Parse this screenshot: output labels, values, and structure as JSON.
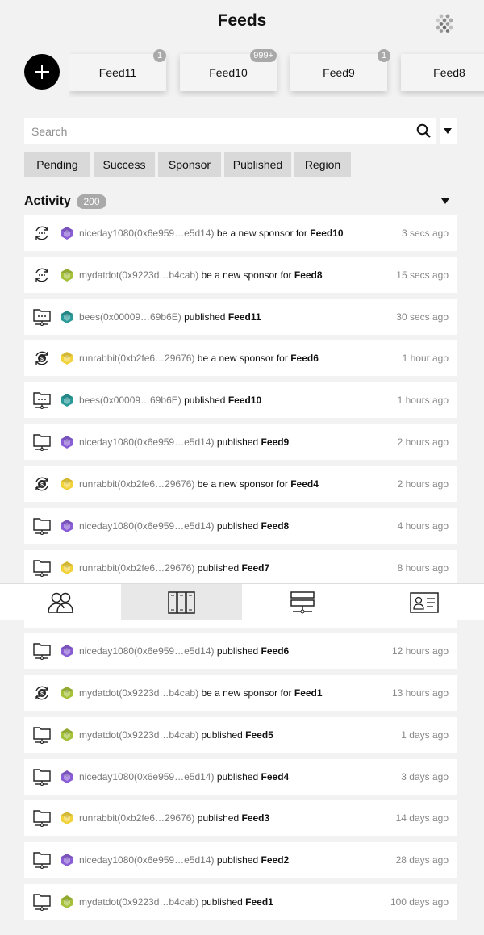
{
  "header": {
    "title": "Feeds",
    "menu_icon": "hexagon-grid-icon"
  },
  "add_button": {
    "icon": "plus-icon"
  },
  "feeds": [
    {
      "label": "Feed11",
      "badge": "1"
    },
    {
      "label": "Feed10",
      "badge": "999+"
    },
    {
      "label": "Feed9",
      "badge": "1"
    },
    {
      "label": "Feed8",
      "badge": ""
    }
  ],
  "search": {
    "placeholder": "Search"
  },
  "filters": [
    "Pending",
    "Success",
    "Sponsor",
    "Published",
    "Region"
  ],
  "activity": {
    "title": "Activity",
    "count": "200",
    "items": [
      {
        "kind": "sponsor-new",
        "avatar": "purple",
        "user": "niceday1080(0x6e959…e5d14)",
        "action": "be a new sponsor for",
        "feed": "Feed10",
        "time": "3 secs ago"
      },
      {
        "kind": "sponsor-new",
        "avatar": "green",
        "user": "mydatdot(0x9223d…b4cab)",
        "action": "be a new sponsor for",
        "feed": "Feed8",
        "time": "15 secs ago"
      },
      {
        "kind": "publish-pending",
        "avatar": "teal",
        "user": "bees(0x00009…69b6E)",
        "action": "published",
        "feed": "Feed11",
        "time": "30 secs ago"
      },
      {
        "kind": "sponsor-paid",
        "avatar": "yellow",
        "user": "runrabbit(0xb2fe6…29676)",
        "action": "be a new sponsor for",
        "feed": "Feed6",
        "time": "1 hour ago"
      },
      {
        "kind": "publish-pending",
        "avatar": "teal",
        "user": "bees(0x00009…69b6E)",
        "action": "published",
        "feed": "Feed10",
        "time": "1 hours ago"
      },
      {
        "kind": "publish",
        "avatar": "purple",
        "user": "niceday1080(0x6e959…e5d14)",
        "action": "published",
        "feed": "Feed9",
        "time": "2 hours ago"
      },
      {
        "kind": "sponsor-paid",
        "avatar": "yellow",
        "user": "runrabbit(0xb2fe6…29676)",
        "action": "be a new sponsor for",
        "feed": "Feed4",
        "time": "2 hours ago"
      },
      {
        "kind": "publish",
        "avatar": "purple",
        "user": "niceday1080(0x6e959…e5d14)",
        "action": "published",
        "feed": "Feed8",
        "time": "4 hours ago"
      },
      {
        "kind": "publish",
        "avatar": "yellow",
        "user": "runrabbit(0xb2fe6…29676)",
        "action": "published",
        "feed": "Feed7",
        "time": "8 hours ago"
      },
      {
        "kind": "publish",
        "avatar": "purple",
        "user": "",
        "action": "",
        "feed": "",
        "time": ""
      },
      {
        "kind": "publish",
        "avatar": "purple",
        "user": "niceday1080(0x6e959…e5d14)",
        "action": "published",
        "feed": "Feed6",
        "time": "12 hours ago"
      },
      {
        "kind": "sponsor-paid",
        "avatar": "green",
        "user": "mydatdot(0x9223d…b4cab)",
        "action": "be a new sponsor for",
        "feed": "Feed1",
        "time": "13 hours ago"
      },
      {
        "kind": "publish",
        "avatar": "green",
        "user": "mydatdot(0x9223d…b4cab)",
        "action": "published",
        "feed": "Feed5",
        "time": "1 days ago"
      },
      {
        "kind": "publish",
        "avatar": "purple",
        "user": "niceday1080(0x6e959…e5d14)",
        "action": "published",
        "feed": "Feed4",
        "time": "3 days ago"
      },
      {
        "kind": "publish",
        "avatar": "yellow",
        "user": "runrabbit(0xb2fe6…29676)",
        "action": "published",
        "feed": "Feed3",
        "time": "14 days ago"
      },
      {
        "kind": "publish",
        "avatar": "purple",
        "user": "niceday1080(0x6e959…e5d14)",
        "action": "published",
        "feed": "Feed2",
        "time": "28 days ago"
      },
      {
        "kind": "publish",
        "avatar": "green",
        "user": "mydatdot(0x9223d…b4cab)",
        "action": "published",
        "feed": "Feed1",
        "time": "100 days ago"
      }
    ]
  },
  "avatar_colors": {
    "purple": "#8a5fd6",
    "green": "#a5c23a",
    "teal": "#2a9a9a",
    "yellow": "#f2d23a"
  },
  "bottom_nav": [
    {
      "name": "community",
      "icon": "users-icon",
      "active": false
    },
    {
      "name": "feeds",
      "icon": "feeds-columns-icon",
      "active": true
    },
    {
      "name": "servers",
      "icon": "server-icon",
      "active": false
    },
    {
      "name": "profile",
      "icon": "id-card-icon",
      "active": false
    }
  ]
}
